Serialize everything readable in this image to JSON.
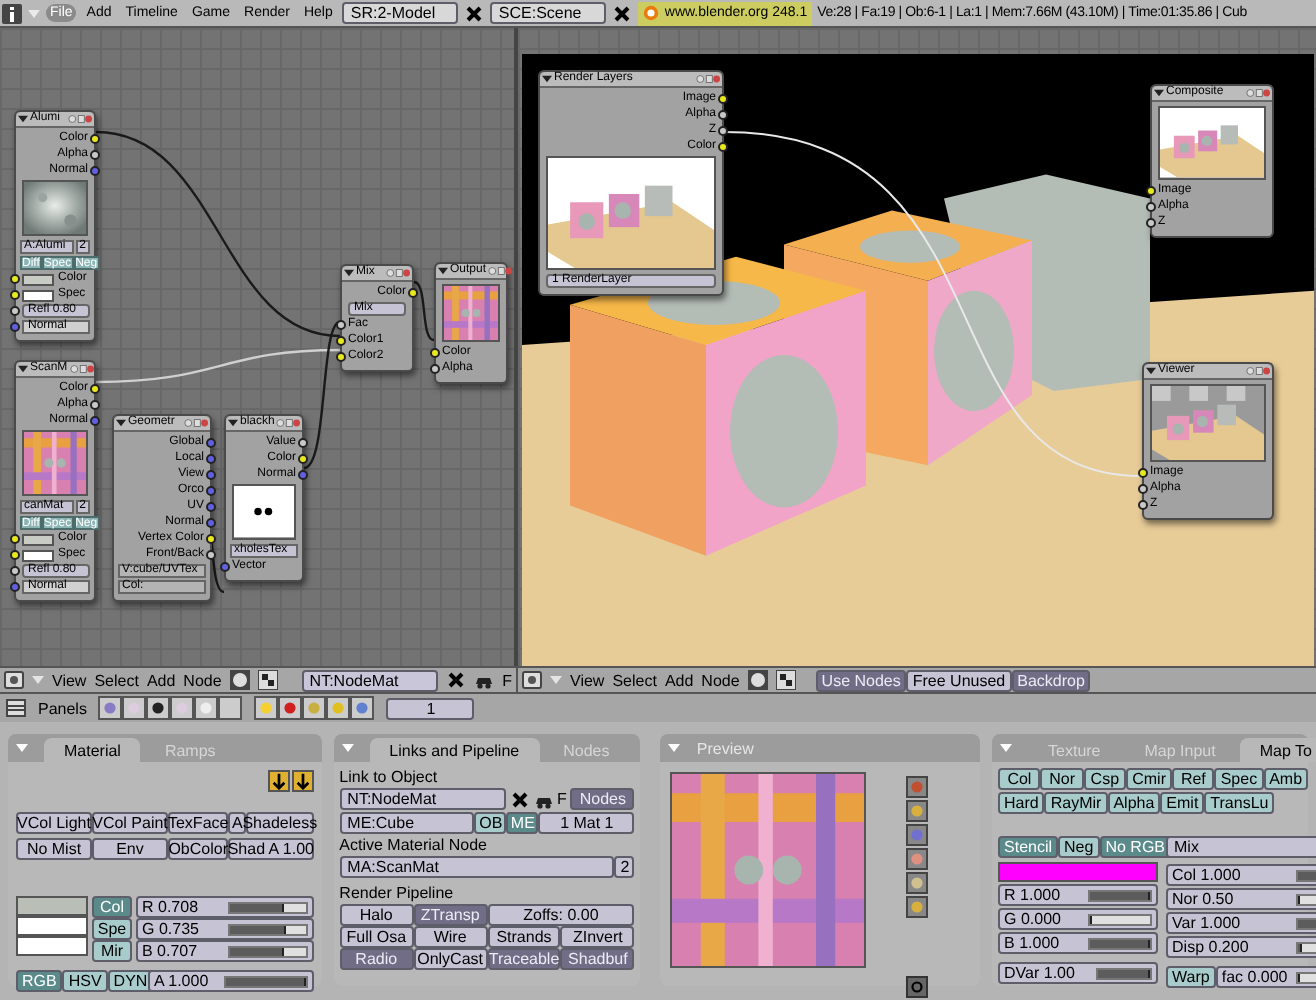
{
  "top_bar": {
    "menus": [
      {
        "label": "File",
        "selected": true
      },
      {
        "label": "Add",
        "selected": false
      },
      {
        "label": "Timeline",
        "selected": false
      },
      {
        "label": "Game",
        "selected": false
      },
      {
        "label": "Render",
        "selected": false
      },
      {
        "label": "Help",
        "selected": false
      }
    ],
    "screen": "SR:2-Model",
    "scene": "SCE:Scene",
    "version": "www.blender.org 248.1",
    "stats": "Ve:28 | Fa:19 | Ob:6-1 | La:1 | Mem:7.66M (43.10M) | Time:01:35.86 | Cub"
  },
  "material_nodes": [
    {
      "title": "Alumi",
      "rows": [
        {
          "kind": "out",
          "label": "Color",
          "color": "#e8e820"
        },
        {
          "kind": "out",
          "label": "Alpha",
          "color": "#c8c8c8"
        },
        {
          "kind": "out",
          "label": "Normal",
          "color": "#6060e0"
        },
        {
          "kind": "picture"
        },
        {
          "kind": "menu",
          "label": "A:Alumi",
          "count": "2"
        },
        {
          "kind": "toggles",
          "items": [
            "Diff",
            "Spec",
            "Neg"
          ]
        },
        {
          "kind": "in_swatch",
          "label": "Color",
          "color": "#e8e820",
          "swatch": {
            "color": "#c8ccc4"
          }
        },
        {
          "kind": "in_swatch",
          "label": "Spec",
          "color": "#e8e820",
          "swatch": {
            "color": "#ffffff"
          }
        },
        {
          "kind": "in_slider",
          "label": "Refl 0.80",
          "color": "#c8c8c8"
        },
        {
          "kind": "in_field",
          "label": "Normal",
          "color": "#6060e0"
        }
      ]
    },
    {
      "title": "ScanM",
      "rows": [
        {
          "kind": "out",
          "label": "Color",
          "color": "#e8e820"
        },
        {
          "kind": "out",
          "label": "Alpha",
          "color": "#c8c8c8"
        },
        {
          "kind": "out",
          "label": "Normal",
          "color": "#6060e0"
        },
        {
          "kind": "picture"
        },
        {
          "kind": "menu",
          "label": "canMat",
          "count": "2"
        },
        {
          "kind": "toggles",
          "items": [
            "Diff",
            "Spec",
            "Neg"
          ]
        },
        {
          "kind": "in_swatch",
          "label": "Color",
          "color": "#e8e820",
          "swatch": {
            "color": "#c8ccc4"
          }
        },
        {
          "kind": "in_swatch",
          "label": "Spec",
          "color": "#e8e820",
          "swatch": {
            "color": "#ffffff"
          }
        },
        {
          "kind": "in_slider",
          "label": "Refl 0.80",
          "color": "#c8c8c8"
        },
        {
          "kind": "in_field",
          "label": "Normal",
          "color": "#6060e0"
        }
      ]
    },
    {
      "title": "Geometr",
      "rows": [
        {
          "kind": "out",
          "label": "Global",
          "color": "#6060e0"
        },
        {
          "kind": "out",
          "label": "Local",
          "color": "#6060e0"
        },
        {
          "kind": "out",
          "label": "View",
          "color": "#6060e0"
        },
        {
          "kind": "out",
          "label": "Orco",
          "color": "#6060e0"
        },
        {
          "kind": "out",
          "label": "UV",
          "color": "#6060e0"
        },
        {
          "kind": "out",
          "label": "Normal",
          "color": "#6060e0"
        },
        {
          "kind": "out",
          "label": "Vertex Color",
          "color": "#e8e820"
        },
        {
          "kind": "out",
          "label": "Front/Back",
          "color": "#c8c8c8"
        },
        {
          "kind": "field",
          "label": "V:cube/UVTex"
        },
        {
          "kind": "field",
          "label": "Col:"
        }
      ]
    },
    {
      "title": "blackh",
      "rows": [
        {
          "kind": "out",
          "label": "Value",
          "color": "#c8c8c8"
        },
        {
          "kind": "out",
          "label": "Color",
          "color": "#e8e820"
        },
        {
          "kind": "out",
          "label": "Normal",
          "color": "#6060e0"
        },
        {
          "kind": "picture"
        },
        {
          "kind": "menu",
          "label": "xholesTex"
        },
        {
          "kind": "in",
          "label": "Vector",
          "color": "#6060e0"
        }
      ]
    },
    {
      "title": "Mix",
      "rows": [
        {
          "kind": "out",
          "label": "Color",
          "color": "#e8e820"
        },
        {
          "kind": "dropdown",
          "label": "Mix"
        },
        {
          "kind": "in",
          "label": "Fac",
          "color": "#c8c8c8"
        },
        {
          "kind": "in",
          "label": "Color1",
          "color": "#e8e820"
        },
        {
          "kind": "in",
          "label": "Color2",
          "color": "#e8e820"
        }
      ]
    },
    {
      "title": "Output",
      "rows": [
        {
          "kind": "picture"
        },
        {
          "kind": "in",
          "label": "Color",
          "color": "#e8e820"
        },
        {
          "kind": "in",
          "label": "Alpha",
          "color": "#c8c8c8"
        }
      ]
    }
  ],
  "composite_nodes": [
    {
      "title": "Render Layers",
      "rows": [
        {
          "kind": "out",
          "label": "Image",
          "color": "#e8e820"
        },
        {
          "kind": "out",
          "label": "Alpha",
          "color": "#c8c8c8"
        },
        {
          "kind": "out",
          "label": "Z",
          "color": "#c8c8c8"
        },
        {
          "kind": "out",
          "label": "Color",
          "color": "#e8e820"
        },
        {
          "kind": "picture"
        },
        {
          "kind": "dropdown",
          "label": "1 RenderLayer"
        }
      ]
    },
    {
      "title": "Composite",
      "rows": [
        {
          "kind": "picture"
        },
        {
          "kind": "in",
          "label": "Image",
          "color": "#e8e820"
        },
        {
          "kind": "in",
          "label": "Alpha",
          "color": "#c8c8c8"
        },
        {
          "kind": "in",
          "label": "Z",
          "color": "#c8c8c8"
        }
      ]
    },
    {
      "title": "Viewer",
      "rows": [
        {
          "kind": "picture"
        },
        {
          "kind": "in",
          "label": "Image",
          "color": "#e8e820"
        },
        {
          "kind": "in",
          "label": "Alpha",
          "color": "#c8c8c8"
        },
        {
          "kind": "in",
          "label": "Z",
          "color": "#c8c8c8"
        }
      ]
    }
  ],
  "node_header_left": {
    "menus": [
      "View",
      "Select",
      "Add",
      "Node"
    ],
    "node_tree": "NT:NodeMat",
    "fake_user": "F"
  },
  "node_header_right": {
    "menus": [
      "View",
      "Select",
      "Add",
      "Node"
    ],
    "toggles": [
      {
        "label": "Use Nodes",
        "selected": true
      },
      {
        "label": "Free Unused",
        "selected": false
      },
      {
        "label": "Backdrop",
        "selected": true
      }
    ]
  },
  "panels_header": {
    "label": "Panels",
    "frame": "1"
  },
  "material_panel": {
    "tabs": [
      {
        "label": "Material",
        "selected": true
      },
      {
        "label": "Ramps",
        "selected": false
      }
    ],
    "toggles": [
      {
        "label": "VCol Light",
        "selected": false
      },
      {
        "label": "VCol Paint",
        "selected": false
      },
      {
        "label": "TexFace",
        "selected": false
      },
      {
        "label": "A",
        "selected": false
      },
      {
        "label": "Shadeless",
        "selected": false
      },
      {
        "label": "No Mist",
        "selected": false
      },
      {
        "label": "Env",
        "selected": false
      },
      {
        "label": "ObColor",
        "selected": false
      },
      {
        "label": "Shad A 1.00",
        "selected": false
      }
    ],
    "swatches": [
      {
        "label": "Col",
        "color": "#b9beb6",
        "selected": true
      },
      {
        "label": "Spe",
        "color": "#ffffff",
        "selected": false
      },
      {
        "label": "Mir",
        "color": "#ffffff",
        "selected": false
      }
    ],
    "sliders": [
      {
        "label": "R 0.708",
        "level": 0.708
      },
      {
        "label": "G 0.735",
        "level": 0.735
      },
      {
        "label": "B 0.707",
        "level": 0.707
      }
    ],
    "modes": [
      {
        "label": "RGB",
        "selected": true
      },
      {
        "label": "HSV",
        "selected": false
      },
      {
        "label": "DYN",
        "selected": false
      }
    ],
    "alpha": {
      "label": "A 1.000",
      "level": 1
    }
  },
  "links_panel": {
    "tabs": [
      {
        "label": "Links and Pipeline",
        "selected": true
      },
      {
        "label": "Nodes",
        "selected": false
      }
    ],
    "link_label": "Link to Object",
    "node_tree": "NT:NodeMat",
    "fake_user": "F",
    "nodes_button": {
      "label": "Nodes",
      "selected": true
    },
    "mesh": "ME:Cube",
    "owners": [
      {
        "label": "OB",
        "selected": false
      },
      {
        "label": "ME",
        "selected": true
      }
    ],
    "mat_index": "1 Mat 1",
    "active_label": "Active Material Node",
    "active_material": "MA:ScanMat",
    "users": "2",
    "pipeline_label": "Render Pipeline",
    "pipeline": [
      {
        "label": "Halo",
        "selected": false,
        "kind": "toggle"
      },
      {
        "label": "ZTransp",
        "selected": true,
        "kind": "toggle"
      },
      {
        "label": "Zoffs: 0.00",
        "kind": "number"
      },
      {
        "label": "Full Osa",
        "selected": false,
        "kind": "toggle"
      },
      {
        "label": "Wire",
        "selected": false,
        "kind": "toggle"
      },
      {
        "label": "Strands",
        "selected": false,
        "kind": "toggle"
      },
      {
        "label": "ZInvert",
        "selected": false,
        "kind": "toggle"
      },
      {
        "label": "Radio",
        "selected": true,
        "kind": "toggle"
      },
      {
        "label": "OnlyCast",
        "selected": false,
        "kind": "toggle"
      },
      {
        "label": "Traceable",
        "selected": true,
        "kind": "toggle"
      },
      {
        "label": "Shadbuf",
        "selected": true,
        "kind": "toggle"
      }
    ]
  },
  "preview_panel": {
    "title": "Preview"
  },
  "texture_panel": {
    "tabs": [
      {
        "label": "Texture",
        "selected": false
      },
      {
        "label": "Map Input",
        "selected": false
      },
      {
        "label": "Map To",
        "selected": true
      }
    ],
    "channels": [
      "Col",
      "Nor",
      "Csp",
      "Cmir",
      "Ref",
      "Spec",
      "Amb",
      "Hard",
      "RayMir",
      "Alpha",
      "Emit",
      "TransLu"
    ],
    "stencil": [
      {
        "label": "Stencil",
        "selected": true
      },
      {
        "label": "Neg",
        "selected": false
      },
      {
        "label": "No RGB",
        "selected": true
      }
    ],
    "color": "#ff00ff",
    "rgb": [
      {
        "label": "R 1.000",
        "level": 1
      },
      {
        "label": "G 0.000",
        "level": 0
      },
      {
        "label": "B 1.000",
        "level": 1
      }
    ],
    "dvar": {
      "label": "DVar 1.00",
      "level": 1
    },
    "blend": "Mix",
    "factors": [
      {
        "label": "Col 1.000",
        "level": 1
      },
      {
        "label": "Nor 0.50",
        "level": 0.02
      },
      {
        "label": "Var 1.000",
        "level": 1
      },
      {
        "label": "Disp 0.200",
        "level": 0.1
      }
    ],
    "warp": {
      "label": "Warp",
      "selected": false
    },
    "warp_fac": {
      "label": "fac 0.000",
      "level": 0
    }
  }
}
